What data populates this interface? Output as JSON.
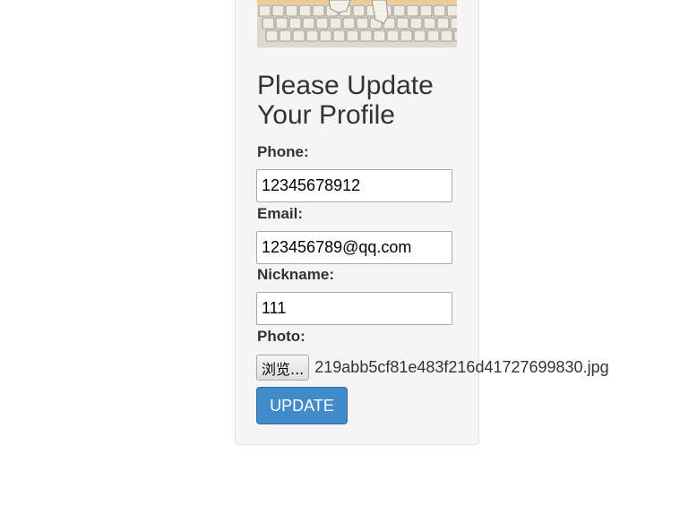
{
  "profile_image": {
    "icon": "keyboard-photo"
  },
  "form": {
    "title": "Please Update Your Profile",
    "phone": {
      "label": "Phone:",
      "value": "12345678912"
    },
    "email": {
      "label": "Email:",
      "value": "123456789@qq.com"
    },
    "nickname": {
      "label": "Nickname:",
      "value": "111"
    },
    "photo": {
      "label": "Photo:",
      "browse_label": "浏览...",
      "file_name": "219abb5cf81e483f216d41727699830.jpg"
    },
    "submit_label": "UPDATE"
  },
  "colors": {
    "panel_bg": "#f5f5f5",
    "primary_button": "#428bca",
    "text": "#333333"
  }
}
